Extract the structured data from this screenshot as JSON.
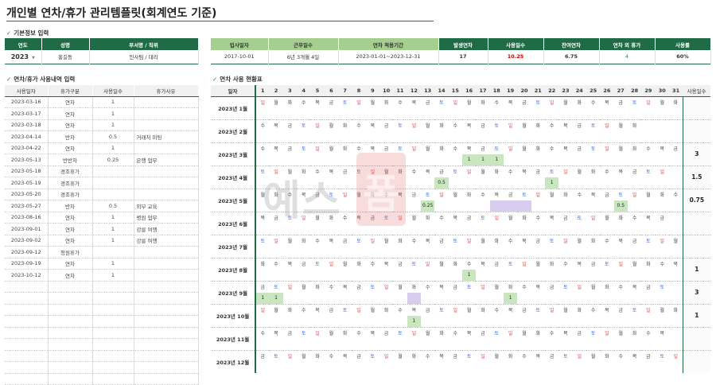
{
  "title": "개인별 연차/휴가 관리템플릿(회계연도 기준)",
  "sections": {
    "basic": "기본정보 입력",
    "usage": "연차/휴가 사용내역 입력",
    "status": "연차 사용 현황표",
    "check": "✓"
  },
  "basic_info": {
    "headers": [
      "연도",
      "성명",
      "부서명 / 직위"
    ],
    "year": "2023",
    "name": "홍길동",
    "dept": "인사팀 / 대리"
  },
  "employment": {
    "headers": [
      "입사일자",
      "근무일수",
      "연차 적용기간",
      "발생연차",
      "사용일수",
      "잔여연차",
      "연차 외 휴가",
      "사용률"
    ],
    "join_date": "2017-10-01",
    "work_period": "6년 3개월 4일",
    "period": "2023-01-01~2023-12-31",
    "accrued": "17",
    "used": "10.25",
    "remaining": "6.75",
    "other_leave": "4",
    "usage_rate": "60%"
  },
  "leave_table": {
    "headers": [
      "사용일자",
      "휴가구분",
      "사용일수",
      "휴가사유"
    ],
    "rows": [
      [
        "2023-03-16",
        "연차",
        "1",
        ""
      ],
      [
        "2023-03-17",
        "연차",
        "1",
        ""
      ],
      [
        "2023-03-18",
        "연차",
        "1",
        ""
      ],
      [
        "2023-04-14",
        "반차",
        "0.5",
        "거래처 미팅"
      ],
      [
        "2023-04-22",
        "연차",
        "1",
        ""
      ],
      [
        "2023-05-13",
        "반반차",
        "0.25",
        "은행 업무"
      ],
      [
        "2023-05-18",
        "경조휴가",
        "",
        ""
      ],
      [
        "2023-05-19",
        "경조휴가",
        "",
        ""
      ],
      [
        "2023-05-20",
        "경조휴가",
        "",
        ""
      ],
      [
        "2023-05-27",
        "반차",
        "0.5",
        "외부 교육"
      ],
      [
        "2023-08-16",
        "연차",
        "1",
        "병원 업무"
      ],
      [
        "2023-09-01",
        "연차",
        "1",
        "강릉 여행"
      ],
      [
        "2023-09-02",
        "연차",
        "1",
        "강릉 여행"
      ],
      [
        "2023-09-12",
        "청원휴가",
        "",
        ""
      ],
      [
        "2023-09-19",
        "연차",
        "1",
        ""
      ],
      [
        "2023-10-12",
        "연차",
        "1",
        ""
      ],
      [
        "",
        "",
        "",
        ""
      ],
      [
        "",
        "",
        "",
        ""
      ],
      [
        "",
        "",
        "",
        ""
      ],
      [
        "",
        "",
        "",
        ""
      ],
      [
        "",
        "",
        "",
        ""
      ],
      [
        "",
        "",
        "",
        ""
      ],
      [
        "",
        "",
        "",
        ""
      ],
      [
        "",
        "",
        "",
        ""
      ],
      [
        "",
        "",
        "",
        ""
      ]
    ]
  },
  "calendar": {
    "day_header": "일자",
    "usage_header": "사용일수",
    "days": [
      "1",
      "2",
      "3",
      "4",
      "5",
      "6",
      "7",
      "8",
      "9",
      "10",
      "11",
      "12",
      "13",
      "14",
      "15",
      "16",
      "17",
      "18",
      "19",
      "20",
      "21",
      "22",
      "23",
      "24",
      "25",
      "26",
      "27",
      "28",
      "29",
      "30",
      "31"
    ],
    "months": [
      {
        "label": "2023년 1월",
        "start": 0,
        "len": 31,
        "usage": "",
        "leaves": [],
        "hl": []
      },
      {
        "label": "2023년 2월",
        "start": 3,
        "len": 28,
        "usage": "",
        "leaves": [],
        "hl": []
      },
      {
        "label": "2023년 3월",
        "start": 3,
        "len": 31,
        "usage": "3",
        "leaves": [
          [
            16,
            "1"
          ],
          [
            17,
            "1"
          ],
          [
            18,
            "1"
          ]
        ],
        "hl": []
      },
      {
        "label": "2023년 4월",
        "start": 6,
        "len": 30,
        "usage": "1.5",
        "leaves": [
          [
            14,
            "0.5"
          ],
          [
            22,
            "1"
          ]
        ],
        "hl": []
      },
      {
        "label": "2023년 5월",
        "start": 1,
        "len": 31,
        "usage": "0.75",
        "leaves": [
          [
            13,
            "0.25"
          ],
          [
            27,
            "0.5"
          ]
        ],
        "hl": [
          18,
          19,
          20
        ]
      },
      {
        "label": "2023년 6월",
        "start": 4,
        "len": 30,
        "usage": "",
        "leaves": [],
        "hl": []
      },
      {
        "label": "2023년 7월",
        "start": 6,
        "len": 31,
        "usage": "",
        "leaves": [],
        "hl": []
      },
      {
        "label": "2023년 8월",
        "start": 2,
        "len": 31,
        "usage": "1",
        "leaves": [
          [
            16,
            "1"
          ]
        ],
        "hl": []
      },
      {
        "label": "2023년 9월",
        "start": 5,
        "len": 30,
        "usage": "3",
        "leaves": [
          [
            1,
            "1"
          ],
          [
            2,
            "1"
          ],
          [
            19,
            "1"
          ]
        ],
        "hl": [
          12
        ]
      },
      {
        "label": "2023년 10월",
        "start": 0,
        "len": 31,
        "usage": "1",
        "leaves": [
          [
            12,
            "1"
          ]
        ],
        "hl": []
      },
      {
        "label": "2023년 11월",
        "start": 3,
        "len": 30,
        "usage": "",
        "leaves": [],
        "hl": []
      },
      {
        "label": "2023년 12월",
        "start": 5,
        "len": 31,
        "usage": "",
        "leaves": [],
        "hl": []
      }
    ],
    "weekdays": [
      "일",
      "월",
      "화",
      "수",
      "목",
      "금",
      "토"
    ]
  },
  "watermark": {
    "text": "예스",
    "mark": "폼"
  },
  "colors": {
    "header_green": "#1f6b46",
    "light_green": "#a5cf8f",
    "leave_green": "#c9e7bf",
    "holiday_purple": "#d8cdee",
    "saturday_blue": "#3a6fd8",
    "sunday_red": "#d84a4a"
  }
}
